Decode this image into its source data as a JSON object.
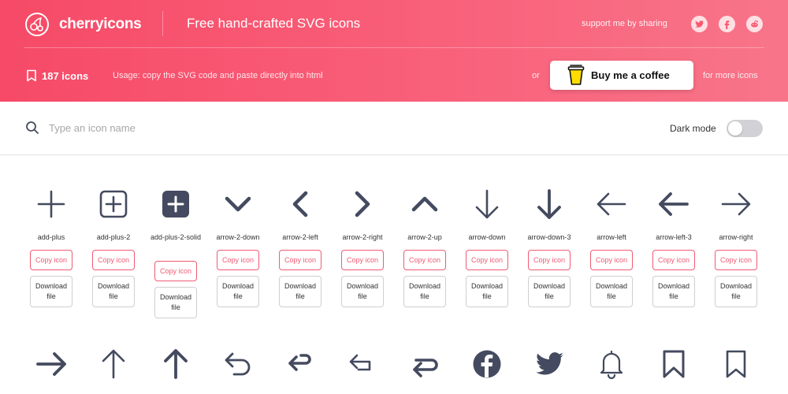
{
  "header": {
    "brand": "cherryicons",
    "tagline": "Free hand-crafted SVG icons",
    "share_text": "support me by sharing",
    "icon_count": "187 icons",
    "usage": "Usage: copy the SVG code and paste directly into html",
    "or_text": "or",
    "coffee_label": "Buy me a coffee",
    "more_text": "for more icons",
    "social": [
      "twitter-icon",
      "facebook-icon",
      "reddit-icon"
    ]
  },
  "search": {
    "placeholder": "Type an icon name",
    "value": "",
    "dark_mode_label": "Dark mode",
    "dark_mode_on": false
  },
  "buttons": {
    "copy": "Copy icon",
    "download": "Download file"
  },
  "colors": {
    "accent": "#f64a67",
    "icon": "#444a5f"
  },
  "icons_row1": [
    {
      "name": "add-plus",
      "icon": "add-plus"
    },
    {
      "name": "add-plus-2",
      "icon": "add-plus-2"
    },
    {
      "name": "add-plus-2-solid",
      "icon": "add-plus-2-solid"
    },
    {
      "name": "arrow-2-down",
      "icon": "arrow-2-down"
    },
    {
      "name": "arrow-2-left",
      "icon": "arrow-2-left"
    },
    {
      "name": "arrow-2-right",
      "icon": "arrow-2-right"
    },
    {
      "name": "arrow-2-up",
      "icon": "arrow-2-up"
    },
    {
      "name": "arrow-down",
      "icon": "arrow-down"
    },
    {
      "name": "arrow-down-3",
      "icon": "arrow-down-3"
    },
    {
      "name": "arrow-left",
      "icon": "arrow-left"
    },
    {
      "name": "arrow-left-3",
      "icon": "arrow-left-3"
    },
    {
      "name": "arrow-right",
      "icon": "arrow-right"
    }
  ],
  "icons_row2": [
    {
      "icon": "arrow-right-3"
    },
    {
      "icon": "arrow-up"
    },
    {
      "icon": "arrow-up-3"
    },
    {
      "icon": "back"
    },
    {
      "icon": "back-3"
    },
    {
      "icon": "back-2"
    },
    {
      "icon": "back-4"
    },
    {
      "icon": "facebook"
    },
    {
      "icon": "twitter"
    },
    {
      "icon": "bell"
    },
    {
      "icon": "bookmark"
    },
    {
      "icon": "bookmark-2"
    }
  ]
}
